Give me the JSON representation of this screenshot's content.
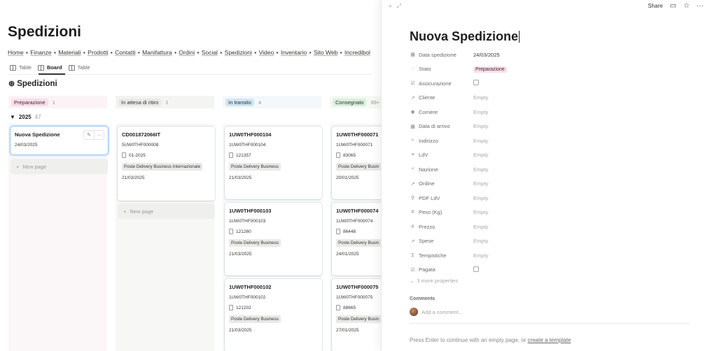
{
  "board": {
    "title": "Spedizioni",
    "nav": [
      "Home",
      "Finanze",
      "Materiali",
      "Prodotti",
      "Contatti",
      "Manifattura",
      "Ordini",
      "Social",
      "Spedizioni",
      "Video",
      "Inventario",
      "Sito Web",
      "Incredibol"
    ],
    "views": [
      {
        "label": "Table",
        "active": false
      },
      {
        "label": "Board",
        "active": true
      },
      {
        "label": "Table",
        "active": false
      }
    ],
    "db_title": "Spedizioni",
    "year": "2025",
    "year_count": "47",
    "groups": [
      {
        "label": "Preparazione",
        "count": "1",
        "bg": "#f6dfe9",
        "fg": "#4c2337"
      },
      {
        "label": "In attesa di ritiro",
        "count": "1",
        "bg": "#e9e9e7",
        "fg": "#37352f"
      },
      {
        "label": "In transito",
        "count": "4",
        "bg": "#d3e5ef",
        "fg": "#183347"
      },
      {
        "label": "Consegnato",
        "count": "99+",
        "bg": "#dbeddb",
        "fg": "#1c3829"
      }
    ],
    "new_page": "New page",
    "col1": {
      "card": {
        "title": "Nuova Spedizione",
        "date": "24/03/2025"
      }
    },
    "col2": {
      "card": {
        "title": "CD001872066IT",
        "code": "5UW0THF000008",
        "order": "01-2025",
        "carrier": "Poste Delivery Business Internazionale",
        "date": "21/03/2025"
      }
    },
    "col3": [
      {
        "title": "1UW0THF000104",
        "code": "1UW0THF000104",
        "order": "121357",
        "carrier": "Poste Delivery Business",
        "date": "21/03/2025"
      },
      {
        "title": "1UW0THF000103",
        "code": "1UW0THF000103",
        "order": "121260",
        "carrier": "Poste Delivery Business",
        "date": "21/03/2025"
      },
      {
        "title": "1UW0THF000102",
        "code": "1UW0THF000102",
        "order": "121202",
        "carrier": "Poste Delivery Business",
        "date": "21/03/2025"
      }
    ],
    "col4": [
      {
        "title": "1UW0THF000071",
        "code": "1UW0THF000071",
        "order": "83065",
        "carrier": "Poste Delivery Busin",
        "date": "20/01/2025"
      },
      {
        "title": "1UW0THF000074",
        "code": "1UW0THF000074",
        "order": "86448",
        "carrier": "Poste Delivery Busin",
        "date": "24/01/2025"
      },
      {
        "title": "1UW0THF000075",
        "code": "1UW0THF000075",
        "order": "88665",
        "carrier": "Poste Delivery Busin",
        "date": "27/01/2025"
      }
    ]
  },
  "panel": {
    "share": "Share",
    "title": "Nuova Spedizione",
    "props": [
      {
        "icon": "calendar-icon",
        "glyph": "▦",
        "name": "Data spedizione",
        "value": "24/03/2025",
        "kind": "text"
      },
      {
        "icon": "status-icon",
        "glyph": "◌",
        "name": "Stato",
        "value": "Preparazione",
        "kind": "tag"
      },
      {
        "icon": "checkbox-prop-icon",
        "glyph": "☑",
        "name": "Assicurazione",
        "value": "",
        "kind": "checkbox"
      },
      {
        "icon": "relation-icon",
        "glyph": "↗",
        "name": "Cliente",
        "value": "Empty",
        "kind": "empty"
      },
      {
        "icon": "select-icon",
        "glyph": "◉",
        "name": "Corriere",
        "value": "Empty",
        "kind": "empty"
      },
      {
        "icon": "calendar-icon",
        "glyph": "▦",
        "name": "Data di arrivo",
        "value": "Empty",
        "kind": "empty"
      },
      {
        "icon": "search-prop-icon",
        "glyph": "⌕",
        "name": "Indirizzo",
        "value": "Empty",
        "kind": "empty"
      },
      {
        "icon": "list-icon",
        "glyph": "≡",
        "name": "LdV",
        "value": "Empty",
        "kind": "empty"
      },
      {
        "icon": "search-prop-icon",
        "glyph": "⌕",
        "name": "Nazione",
        "value": "Empty",
        "kind": "empty"
      },
      {
        "icon": "relation-icon",
        "glyph": "↗",
        "name": "Ordine",
        "value": "Empty",
        "kind": "empty"
      },
      {
        "icon": "attachment-icon",
        "glyph": "⚲",
        "name": "PDF LdV",
        "value": "Empty",
        "kind": "empty"
      },
      {
        "icon": "number-icon",
        "glyph": "#",
        "name": "Peso (Kg)",
        "value": "Empty",
        "kind": "empty"
      },
      {
        "icon": "number-icon",
        "glyph": "#",
        "name": "Prezzo",
        "value": "Empty",
        "kind": "empty"
      },
      {
        "icon": "relation-icon",
        "glyph": "↗",
        "name": "Spese",
        "value": "Empty",
        "kind": "empty"
      },
      {
        "icon": "formula-icon",
        "glyph": "Σ",
        "name": "Tempistiche",
        "value": "Empty",
        "kind": "empty"
      },
      {
        "icon": "checkbox-prop-icon",
        "glyph": "☑",
        "name": "Pagata",
        "value": "",
        "kind": "checkbox"
      }
    ],
    "more_props": "3 more properties",
    "comments_label": "Comments",
    "comment_placeholder": "Add a comment...",
    "footer_text": "Press Enter to continue with an empty page, or ",
    "footer_link": "create a template"
  }
}
